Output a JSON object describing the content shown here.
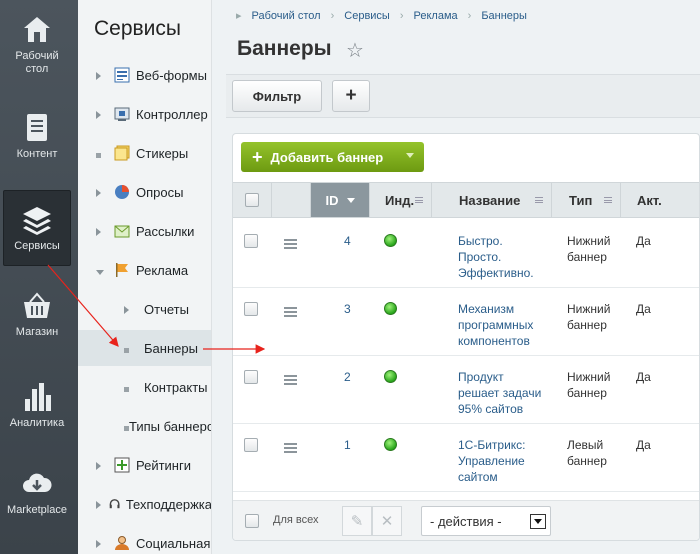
{
  "rail": [
    {
      "label": "Рабочий стол",
      "icon": "home-icon"
    },
    {
      "label": "Контент",
      "icon": "document-icon"
    },
    {
      "label": "Сервисы",
      "icon": "layers-icon",
      "active": true
    },
    {
      "label": "Магазин",
      "icon": "basket-icon"
    },
    {
      "label": "Аналитика",
      "icon": "bar-chart-icon"
    },
    {
      "label": "Marketplace",
      "icon": "cloud-download-icon"
    }
  ],
  "services": {
    "title": "Сервисы",
    "items": [
      {
        "label": "Веб-формы",
        "marker": "arrow",
        "icon": "form-icon"
      },
      {
        "label": "Контроллер",
        "marker": "arrow",
        "icon": "controller-icon"
      },
      {
        "label": "Стикеры",
        "marker": "dot",
        "icon": "sticker-icon"
      },
      {
        "label": "Опросы",
        "marker": "arrow",
        "icon": "pie-icon"
      },
      {
        "label": "Рассылки",
        "marker": "arrow",
        "icon": "mail-icon"
      },
      {
        "label": "Реклама",
        "marker": "arrow-down",
        "icon": "flag-icon"
      },
      {
        "label": "Отчеты",
        "marker": "arrow",
        "sub": true
      },
      {
        "label": "Баннеры",
        "marker": "dot",
        "sub": true,
        "selected": true
      },
      {
        "label": "Контракты",
        "marker": "dot",
        "sub": true
      },
      {
        "label": "Типы баннеров",
        "marker": "dot",
        "sub": true
      },
      {
        "label": "Рейтинги",
        "marker": "arrow",
        "icon": "plus-box-icon"
      },
      {
        "label": "Техподдержка",
        "marker": "arrow",
        "icon": "headset-icon"
      },
      {
        "label": "Социальная",
        "marker": "arrow",
        "icon": "users-icon"
      }
    ]
  },
  "breadcrumb": [
    "Рабочий стол",
    "Сервисы",
    "Реклама",
    "Баннеры"
  ],
  "page_title": "Баннеры",
  "toolbar": {
    "filter_label": "Фильтр",
    "add_label": "+"
  },
  "panel": {
    "add_button": "Добавить баннер",
    "columns": [
      "ID",
      "Инд.",
      "Название",
      "Тип",
      "Акт."
    ],
    "rows": [
      {
        "id": "4",
        "name": [
          "Быстро.",
          "Просто.",
          "Эффективно."
        ],
        "type": [
          "Нижний",
          "баннер"
        ],
        "active": "Да"
      },
      {
        "id": "3",
        "name": [
          "Механизм",
          "программных",
          "компонентов"
        ],
        "type": [
          "Нижний",
          "баннер"
        ],
        "active": "Да"
      },
      {
        "id": "2",
        "name": [
          "Продукт",
          "решает задачи",
          "95% сайтов"
        ],
        "type": [
          "Нижний",
          "баннер"
        ],
        "active": "Да"
      },
      {
        "id": "1",
        "name": [
          "1С-Битрикс:",
          "Управление",
          "сайтом"
        ],
        "type": [
          "Левый",
          "баннер"
        ],
        "active": "Да"
      }
    ],
    "footer": {
      "for_all": "Для всех",
      "actions": "- действия -"
    }
  },
  "colors": {
    "accent_green": "#7fae1c",
    "link": "#2a5d8a",
    "annotation_arrow": "#e8231c"
  }
}
